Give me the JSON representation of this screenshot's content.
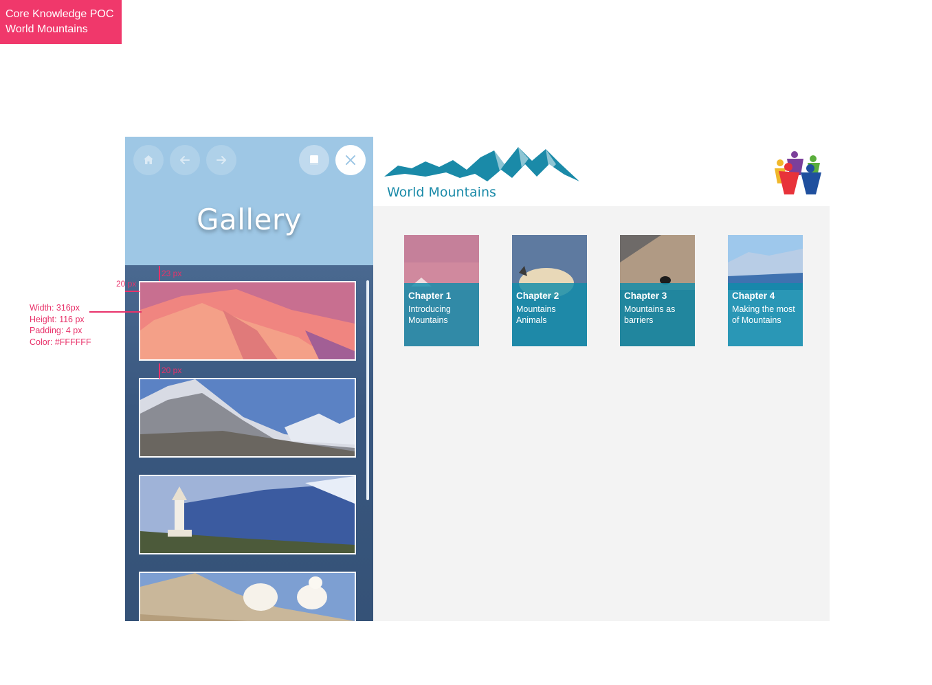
{
  "tag": {
    "line1": "Core Knowledge POC",
    "line2": "World Mountains"
  },
  "annotations": {
    "top_gap": "23 px",
    "left_gap": "20 px",
    "between_gap": "20 px",
    "spec": {
      "width": "Width: 316px",
      "height": "Height: 116 px",
      "padding": "Padding: 4 px",
      "color": "Color: #FFFFFF"
    }
  },
  "sidebar": {
    "title": "Gallery",
    "icons": [
      "home-icon",
      "arrow-left-icon",
      "arrow-right-icon",
      "book-icon",
      "close-icon"
    ]
  },
  "app": {
    "title": "World Mountains"
  },
  "chapters": [
    {
      "number": "Chapter 1",
      "name_l1": "Introducing",
      "name_l2": "Mountains"
    },
    {
      "number": "Chapter 2",
      "name_l1": "Mountains",
      "name_l2": "Animals"
    },
    {
      "number": "Chapter 3",
      "name_l1": "Mountains as",
      "name_l2": "barriers"
    },
    {
      "number": "Chapter 4",
      "name_l1": "Making the most",
      "name_l2": "of Mountains"
    }
  ],
  "colors": {
    "accent": "#1a8aa8",
    "tag": "#f0386b",
    "annotation": "#e8326a",
    "sidebar_head": "#9ec7e5"
  }
}
